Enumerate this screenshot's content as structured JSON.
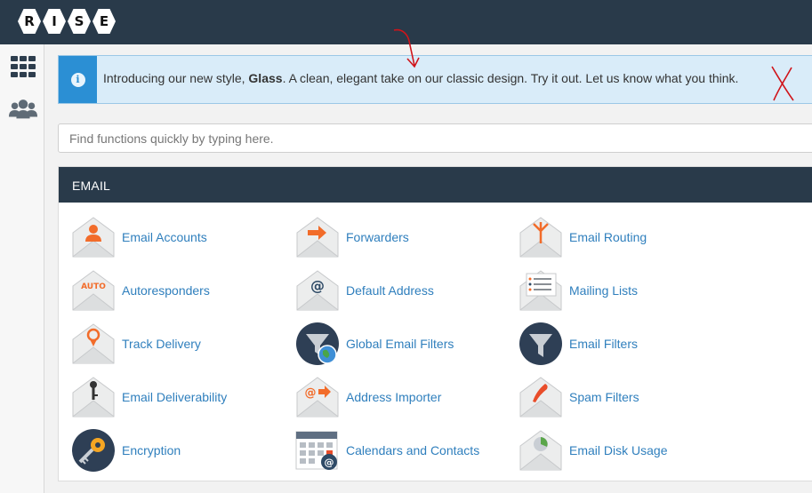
{
  "brand": {
    "letters": [
      "R",
      "I",
      "S",
      "E"
    ]
  },
  "notice": {
    "intro": "Introducing our new style, ",
    "highlight": "Glass",
    "rest": ". A clean, elegant take on our classic design. Try it out. Let us know what you think."
  },
  "search": {
    "placeholder": "Find functions quickly by typing here."
  },
  "email_section": {
    "title": "EMAIL",
    "items": [
      {
        "label": "Email Accounts"
      },
      {
        "label": "Forwarders"
      },
      {
        "label": "Email Routing"
      },
      {
        "label": "Autoresponders"
      },
      {
        "label": "Default Address"
      },
      {
        "label": "Mailing Lists"
      },
      {
        "label": "Track Delivery"
      },
      {
        "label": "Global Email Filters"
      },
      {
        "label": "Email Filters"
      },
      {
        "label": "Email Deliverability"
      },
      {
        "label": "Address Importer"
      },
      {
        "label": "Spam Filters"
      },
      {
        "label": "Encryption"
      },
      {
        "label": "Calendars and Contacts"
      },
      {
        "label": "Email Disk Usage"
      }
    ]
  },
  "icons": {
    "sidebar": [
      "grid-icon",
      "users-icon"
    ],
    "notice": "info-icon"
  },
  "colors": {
    "header": "#293a4a",
    "link": "#2f7fbd",
    "notice_accent": "#2b8fd4",
    "icon_orange": "#f26c2a"
  }
}
